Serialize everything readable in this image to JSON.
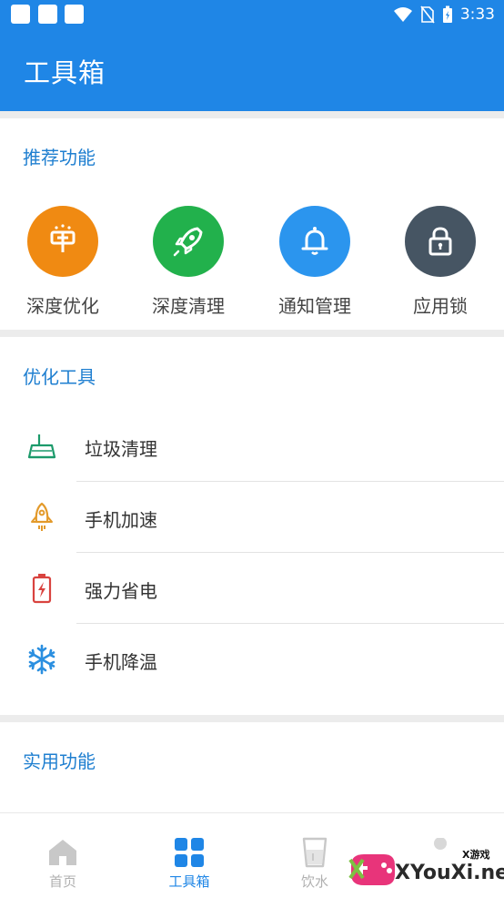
{
  "status_bar": {
    "time": "3:33"
  },
  "header": {
    "title": "工具箱"
  },
  "recommended": {
    "title": "推荐功能",
    "items": [
      {
        "label": "深度优化",
        "icon": "deep-optimize-icon",
        "color": "#f08a12"
      },
      {
        "label": "深度清理",
        "icon": "rocket-icon",
        "color": "#22b14c"
      },
      {
        "label": "通知管理",
        "icon": "bell-icon",
        "color": "#2b95ee"
      },
      {
        "label": "应用锁",
        "icon": "lock-icon",
        "color": "#465563"
      }
    ]
  },
  "optimize": {
    "title": "优化工具",
    "items": [
      {
        "label": "垃圾清理",
        "icon": "broom-icon",
        "color": "#1c9a6b"
      },
      {
        "label": "手机加速",
        "icon": "rocket-outline-icon",
        "color": "#e39a2b"
      },
      {
        "label": "强力省电",
        "icon": "battery-icon",
        "color": "#d9433f"
      },
      {
        "label": "手机降温",
        "icon": "snowflake-icon",
        "color": "#2b8fe0"
      }
    ]
  },
  "practical": {
    "title": "实用功能"
  },
  "bottom_nav": {
    "items": [
      {
        "label": "首页",
        "icon": "home-icon",
        "active": false
      },
      {
        "label": "工具箱",
        "icon": "grid-icon",
        "active": true
      },
      {
        "label": "饮水",
        "icon": "cup-icon",
        "active": false
      }
    ]
  },
  "watermark": {
    "brand": "XYouXi.net",
    "tag": "X游戏"
  },
  "colors": {
    "primary": "#1f86e6",
    "section_title": "#1f7fd0",
    "background": "#ececec"
  }
}
